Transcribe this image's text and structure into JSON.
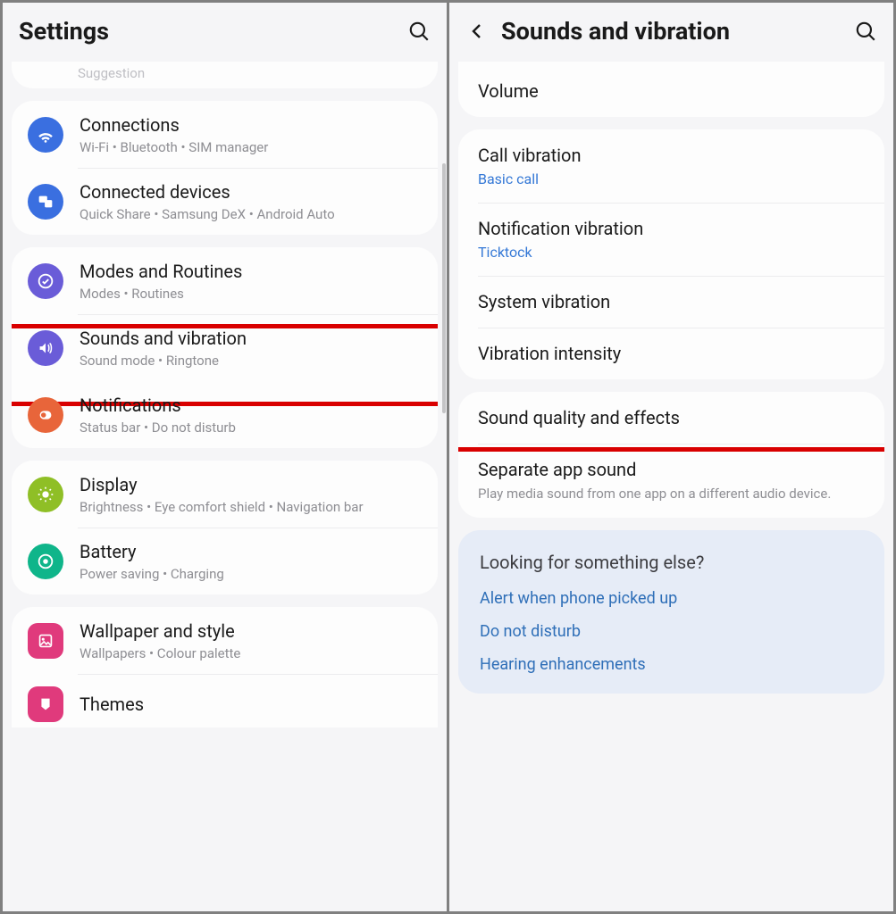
{
  "left": {
    "header_title": "Settings",
    "suggestion_cut": "Suggestion",
    "groups": [
      {
        "items": [
          {
            "icon": "wifi",
            "color": "#3a6fe0",
            "title": "Connections",
            "subtitle": "Wi-Fi  •  Bluetooth  •  SIM manager"
          },
          {
            "icon": "devices",
            "color": "#3a6fe0",
            "title": "Connected devices",
            "subtitle": "Quick Share  •  Samsung DeX  •  Android Auto"
          }
        ]
      },
      {
        "items": [
          {
            "icon": "check",
            "color": "#6a5cd8",
            "title": "Modes and Routines",
            "subtitle": "Modes  •  Routines"
          },
          {
            "icon": "sound",
            "color": "#6a5cd8",
            "title": "Sounds and vibration",
            "subtitle": "Sound mode  •  Ringtone",
            "highlighted": true
          },
          {
            "icon": "notif",
            "color": "#e8653a",
            "title": "Notifications",
            "subtitle": "Status bar  •  Do not disturb"
          }
        ]
      },
      {
        "items": [
          {
            "icon": "display",
            "color": "#8fbf26",
            "title": "Display",
            "subtitle": "Brightness  •  Eye comfort shield  •  Navigation bar"
          },
          {
            "icon": "battery",
            "color": "#0fb58a",
            "title": "Battery",
            "subtitle": "Power saving  •  Charging"
          }
        ]
      },
      {
        "items": [
          {
            "icon": "wallpaper",
            "color": "#e03a7c",
            "title": "Wallpaper and style",
            "subtitle": "Wallpapers  •  Colour palette"
          },
          {
            "icon": "themes",
            "color": "#e03a7c",
            "title": "Themes",
            "subtitle": ""
          }
        ]
      }
    ]
  },
  "right": {
    "header_title": "Sounds and vibration",
    "groups": [
      [
        {
          "title": "Volume"
        }
      ],
      [
        {
          "title": "Call vibration",
          "sub": "Basic call"
        },
        {
          "title": "Notification vibration",
          "sub": "Ticktock"
        },
        {
          "title": "System vibration"
        },
        {
          "title": "Vibration intensity"
        }
      ],
      [
        {
          "title": "Sound quality and effects"
        },
        {
          "title": "Separate app sound",
          "desc": "Play media sound from one app on a different audio device.",
          "highlighted": true
        }
      ]
    ],
    "looking": {
      "heading": "Looking for something else?",
      "links": [
        "Alert when phone picked up",
        "Do not disturb",
        "Hearing enhancements"
      ]
    }
  }
}
